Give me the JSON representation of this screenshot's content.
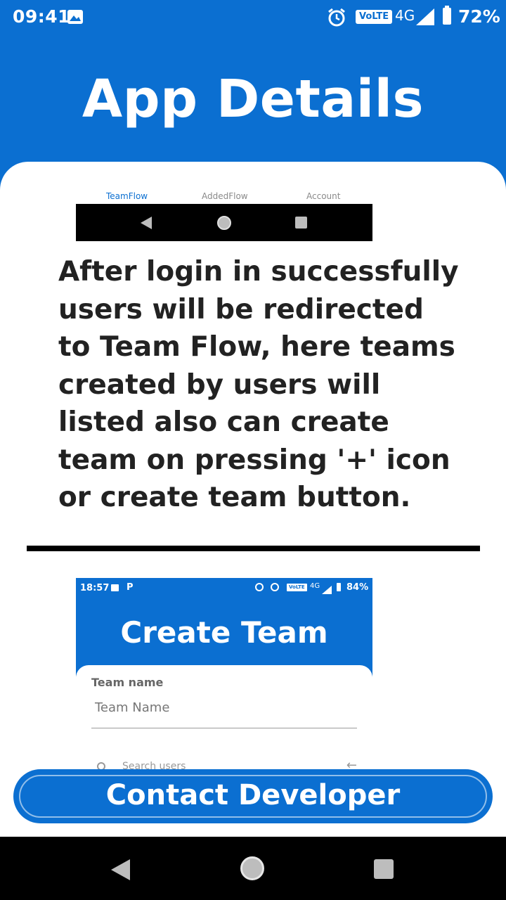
{
  "status_bar": {
    "time": "09:41",
    "network_badge": "VoLTE",
    "network_type": "4G",
    "battery": "72%"
  },
  "header": {
    "title": "App Details"
  },
  "preview_top": {
    "tabs": [
      "TeamFlow",
      "AddedFlow",
      "Account"
    ],
    "active_tab": "TeamFlow"
  },
  "description": "After login in successfully users will be redirected to Team Flow, here teams created by users will listed also can create team on pressing '+' icon or create team button.",
  "preview_create_team": {
    "status_time": "18:57",
    "status_p": "P",
    "network_badge": "VoLTE",
    "network_type": "4G",
    "battery": "84%",
    "title": "Create Team",
    "field_label": "Team name",
    "field_placeholder": "Team Name",
    "search_placeholder": "Search users",
    "arrow": "←"
  },
  "contact_button": {
    "label": "Contact Developer"
  },
  "colors": {
    "primary": "#0b6fd1",
    "text_dark": "#222222"
  }
}
